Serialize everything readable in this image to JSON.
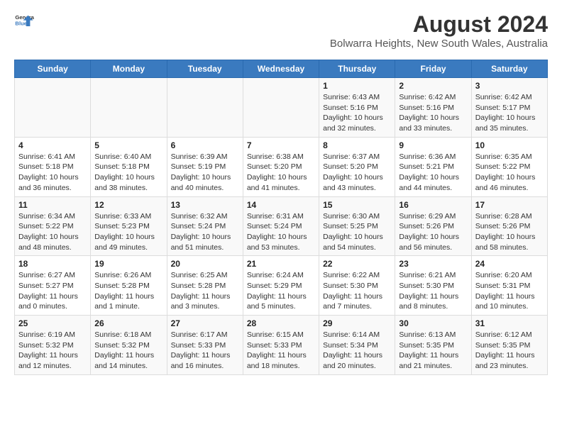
{
  "logo": {
    "line1": "General",
    "line2": "Blue"
  },
  "title": "August 2024",
  "subtitle": "Bolwarra Heights, New South Wales, Australia",
  "weekdays": [
    "Sunday",
    "Monday",
    "Tuesday",
    "Wednesday",
    "Thursday",
    "Friday",
    "Saturday"
  ],
  "weeks": [
    [
      {
        "day": "",
        "info": ""
      },
      {
        "day": "",
        "info": ""
      },
      {
        "day": "",
        "info": ""
      },
      {
        "day": "",
        "info": ""
      },
      {
        "day": "1",
        "info": "Sunrise: 6:43 AM\nSunset: 5:16 PM\nDaylight: 10 hours\nand 32 minutes."
      },
      {
        "day": "2",
        "info": "Sunrise: 6:42 AM\nSunset: 5:16 PM\nDaylight: 10 hours\nand 33 minutes."
      },
      {
        "day": "3",
        "info": "Sunrise: 6:42 AM\nSunset: 5:17 PM\nDaylight: 10 hours\nand 35 minutes."
      }
    ],
    [
      {
        "day": "4",
        "info": "Sunrise: 6:41 AM\nSunset: 5:18 PM\nDaylight: 10 hours\nand 36 minutes."
      },
      {
        "day": "5",
        "info": "Sunrise: 6:40 AM\nSunset: 5:18 PM\nDaylight: 10 hours\nand 38 minutes."
      },
      {
        "day": "6",
        "info": "Sunrise: 6:39 AM\nSunset: 5:19 PM\nDaylight: 10 hours\nand 40 minutes."
      },
      {
        "day": "7",
        "info": "Sunrise: 6:38 AM\nSunset: 5:20 PM\nDaylight: 10 hours\nand 41 minutes."
      },
      {
        "day": "8",
        "info": "Sunrise: 6:37 AM\nSunset: 5:20 PM\nDaylight: 10 hours\nand 43 minutes."
      },
      {
        "day": "9",
        "info": "Sunrise: 6:36 AM\nSunset: 5:21 PM\nDaylight: 10 hours\nand 44 minutes."
      },
      {
        "day": "10",
        "info": "Sunrise: 6:35 AM\nSunset: 5:22 PM\nDaylight: 10 hours\nand 46 minutes."
      }
    ],
    [
      {
        "day": "11",
        "info": "Sunrise: 6:34 AM\nSunset: 5:22 PM\nDaylight: 10 hours\nand 48 minutes."
      },
      {
        "day": "12",
        "info": "Sunrise: 6:33 AM\nSunset: 5:23 PM\nDaylight: 10 hours\nand 49 minutes."
      },
      {
        "day": "13",
        "info": "Sunrise: 6:32 AM\nSunset: 5:24 PM\nDaylight: 10 hours\nand 51 minutes."
      },
      {
        "day": "14",
        "info": "Sunrise: 6:31 AM\nSunset: 5:24 PM\nDaylight: 10 hours\nand 53 minutes."
      },
      {
        "day": "15",
        "info": "Sunrise: 6:30 AM\nSunset: 5:25 PM\nDaylight: 10 hours\nand 54 minutes."
      },
      {
        "day": "16",
        "info": "Sunrise: 6:29 AM\nSunset: 5:26 PM\nDaylight: 10 hours\nand 56 minutes."
      },
      {
        "day": "17",
        "info": "Sunrise: 6:28 AM\nSunset: 5:26 PM\nDaylight: 10 hours\nand 58 minutes."
      }
    ],
    [
      {
        "day": "18",
        "info": "Sunrise: 6:27 AM\nSunset: 5:27 PM\nDaylight: 11 hours\nand 0 minutes."
      },
      {
        "day": "19",
        "info": "Sunrise: 6:26 AM\nSunset: 5:28 PM\nDaylight: 11 hours\nand 1 minute."
      },
      {
        "day": "20",
        "info": "Sunrise: 6:25 AM\nSunset: 5:28 PM\nDaylight: 11 hours\nand 3 minutes."
      },
      {
        "day": "21",
        "info": "Sunrise: 6:24 AM\nSunset: 5:29 PM\nDaylight: 11 hours\nand 5 minutes."
      },
      {
        "day": "22",
        "info": "Sunrise: 6:22 AM\nSunset: 5:30 PM\nDaylight: 11 hours\nand 7 minutes."
      },
      {
        "day": "23",
        "info": "Sunrise: 6:21 AM\nSunset: 5:30 PM\nDaylight: 11 hours\nand 8 minutes."
      },
      {
        "day": "24",
        "info": "Sunrise: 6:20 AM\nSunset: 5:31 PM\nDaylight: 11 hours\nand 10 minutes."
      }
    ],
    [
      {
        "day": "25",
        "info": "Sunrise: 6:19 AM\nSunset: 5:32 PM\nDaylight: 11 hours\nand 12 minutes."
      },
      {
        "day": "26",
        "info": "Sunrise: 6:18 AM\nSunset: 5:32 PM\nDaylight: 11 hours\nand 14 minutes."
      },
      {
        "day": "27",
        "info": "Sunrise: 6:17 AM\nSunset: 5:33 PM\nDaylight: 11 hours\nand 16 minutes."
      },
      {
        "day": "28",
        "info": "Sunrise: 6:15 AM\nSunset: 5:33 PM\nDaylight: 11 hours\nand 18 minutes."
      },
      {
        "day": "29",
        "info": "Sunrise: 6:14 AM\nSunset: 5:34 PM\nDaylight: 11 hours\nand 20 minutes."
      },
      {
        "day": "30",
        "info": "Sunrise: 6:13 AM\nSunset: 5:35 PM\nDaylight: 11 hours\nand 21 minutes."
      },
      {
        "day": "31",
        "info": "Sunrise: 6:12 AM\nSunset: 5:35 PM\nDaylight: 11 hours\nand 23 minutes."
      }
    ]
  ]
}
